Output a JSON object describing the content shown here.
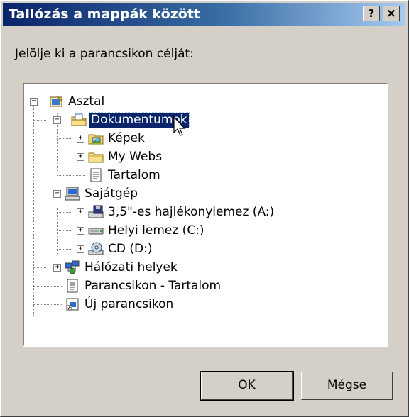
{
  "dialog": {
    "title": "Tallózás a mappák között",
    "help_glyph": "?",
    "close_glyph": "×",
    "prompt": "Jelölje ki a parancsikon célját:"
  },
  "tree": {
    "nodes": [
      {
        "label": "Asztal",
        "icon": "desktop-icon",
        "expander": "−"
      },
      {
        "label": "Dokumentumok",
        "icon": "my-documents-folder-icon",
        "expander": "−",
        "selected": true
      },
      {
        "label": "Képek",
        "icon": "pictures-folder-icon",
        "expander": "+"
      },
      {
        "label": "My Webs",
        "icon": "folder-icon",
        "expander": "+"
      },
      {
        "label": "Tartalom",
        "icon": "document-icon"
      },
      {
        "label": "Sajátgép",
        "icon": "my-computer-icon",
        "expander": "−"
      },
      {
        "label": "3,5\"-es hajlékonylemez (A:)",
        "icon": "floppy-drive-icon",
        "expander": "+"
      },
      {
        "label": "Helyi lemez (C:)",
        "icon": "hard-drive-icon",
        "expander": "+"
      },
      {
        "label": "CD (D:)",
        "icon": "cd-drive-icon",
        "expander": "+"
      },
      {
        "label": "Hálózati helyek",
        "icon": "network-places-icon",
        "expander": "+"
      },
      {
        "label": "Parancsikon - Tartalom",
        "icon": "document-icon"
      },
      {
        "label": "Új parancsikon",
        "icon": "shortcut-icon"
      }
    ]
  },
  "buttons": {
    "ok": "OK",
    "cancel": "Mégse"
  }
}
